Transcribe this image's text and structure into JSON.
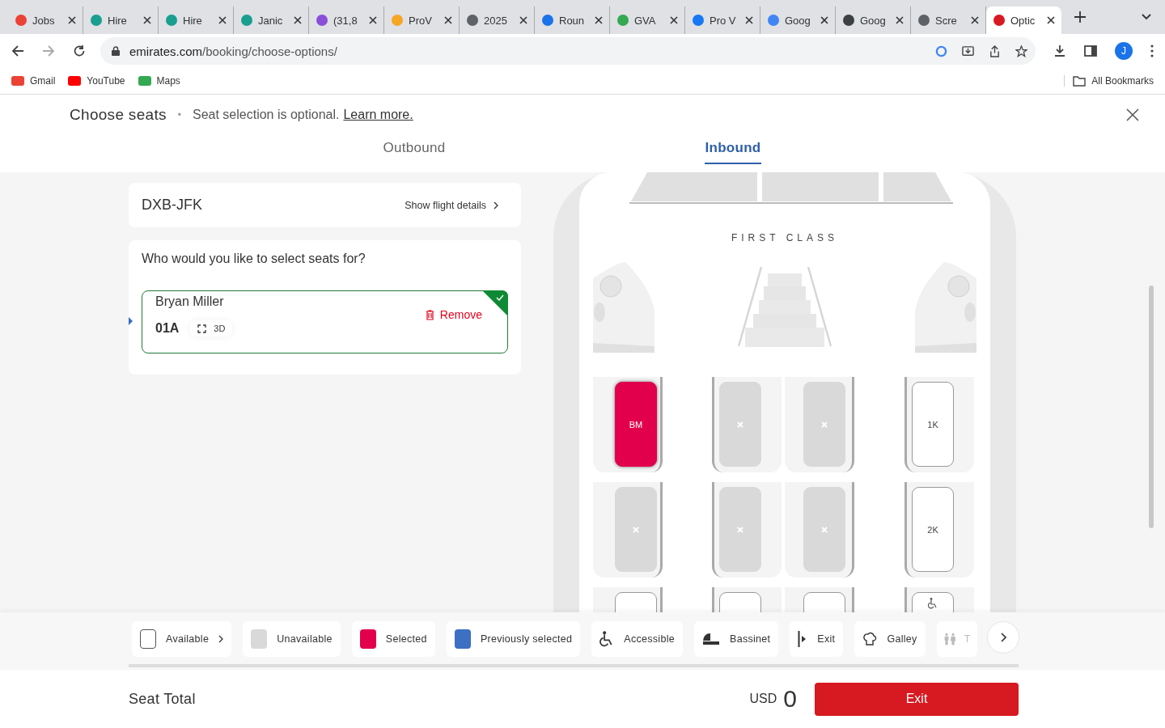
{
  "browser": {
    "tabs": [
      {
        "title": "Jobs",
        "color": "#ea4335",
        "selected": false
      },
      {
        "title": "Hire",
        "color": "#1a9e8f",
        "selected": false
      },
      {
        "title": "Hire",
        "color": "#1a9e8f",
        "selected": false
      },
      {
        "title": "Janic",
        "color": "#1a9e8f",
        "selected": false
      },
      {
        "title": "(31,8",
        "color": "#8a4fd8",
        "selected": false
      },
      {
        "title": "ProV",
        "color": "#f5a623",
        "selected": false
      },
      {
        "title": "2025",
        "color": "#5f6368",
        "selected": false
      },
      {
        "title": "Roun",
        "color": "#1a73e8",
        "selected": false
      },
      {
        "title": "GVA",
        "color": "#34a853",
        "selected": false
      },
      {
        "title": "Pro V",
        "color": "#1877f2",
        "selected": false
      },
      {
        "title": "Goog",
        "color": "#4285f4",
        "selected": false
      },
      {
        "title": "Goog",
        "color": "#3c4043",
        "selected": false
      },
      {
        "title": "Scre",
        "color": "#5f6368",
        "selected": false
      },
      {
        "title": "Optic",
        "color": "#d71921",
        "selected": true
      }
    ],
    "url_domain": "emirates.com",
    "url_path": "/booking/choose-options/",
    "bookmarks": [
      "Gmail",
      "YouTube",
      "Maps"
    ],
    "all_bookmarks": "All Bookmarks",
    "profile_initial": "J"
  },
  "header": {
    "title": "Choose seats",
    "separator": "•",
    "note": "Seat selection is optional.",
    "link": "Learn more."
  },
  "flight_tabs": [
    {
      "label": "Outbound",
      "selected": false
    },
    {
      "label": "Inbound",
      "selected": true
    }
  ],
  "flight": {
    "route": "DXB-JFK",
    "details_link": "Show flight details"
  },
  "passengers": {
    "question": "Who would you like to select seats for?",
    "items": [
      {
        "name": "Bryan Miller",
        "seat": "01A",
        "view_3d": "3D",
        "remove": "Remove",
        "selected": true
      }
    ]
  },
  "seat_map": {
    "cabin_label": "FIRST CLASS",
    "rows": [
      {
        "seats": [
          {
            "kind": "selected",
            "label": "BM"
          },
          {
            "kind": "unavailable"
          },
          {
            "kind": "unavailable"
          },
          {
            "kind": "available",
            "label": "1K"
          }
        ]
      },
      {
        "seats": [
          {
            "kind": "unavailable"
          },
          {
            "kind": "unavailable"
          },
          {
            "kind": "unavailable"
          },
          {
            "kind": "available",
            "label": "2K"
          }
        ]
      },
      {
        "seats": [
          {
            "kind": "available"
          },
          {
            "kind": "available"
          },
          {
            "kind": "available"
          },
          {
            "kind": "accessible"
          }
        ]
      }
    ]
  },
  "legend": [
    {
      "kind": "available",
      "label": "Available"
    },
    {
      "kind": "unavailable",
      "label": "Unavailable"
    },
    {
      "kind": "selected",
      "label": "Selected"
    },
    {
      "kind": "previous",
      "label": "Previously selected"
    },
    {
      "kind": "accessible",
      "label": "Accessible"
    },
    {
      "kind": "bassinet",
      "label": "Bassinet"
    },
    {
      "kind": "exit",
      "label": "Exit"
    },
    {
      "kind": "galley",
      "label": "Galley"
    },
    {
      "kind": "toilet",
      "label": "T"
    }
  ],
  "footer": {
    "label": "Seat Total",
    "currency": "USD",
    "amount": "0",
    "button": "Exit"
  }
}
